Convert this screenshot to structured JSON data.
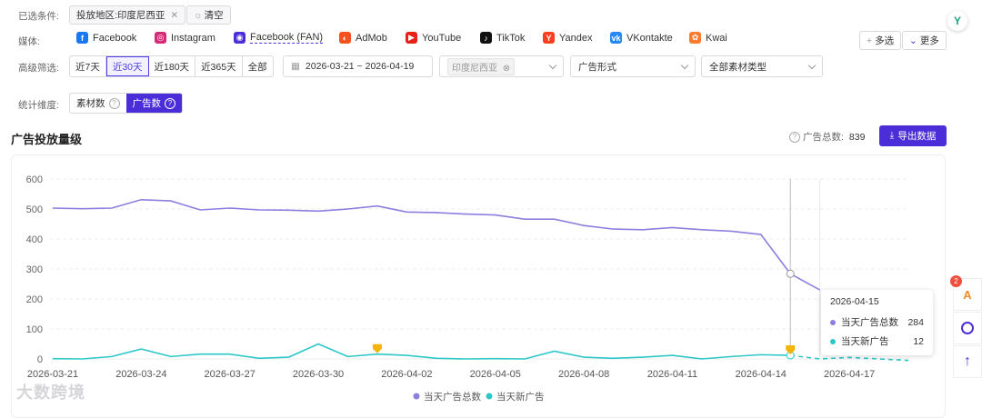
{
  "filters": {
    "label": "已选条件:",
    "region_tag": "投放地区:印度尼西亚",
    "clear_label": "清空"
  },
  "media": {
    "label": "媒体:",
    "items": [
      {
        "name": "Facebook",
        "color": "#1877f2"
      },
      {
        "name": "Instagram",
        "color": "#d62976"
      },
      {
        "name": "Facebook (FAN)",
        "color": "#4b2ed8"
      },
      {
        "name": "AdMob",
        "color": "#f4511e"
      },
      {
        "name": "YouTube",
        "color": "#e62117"
      },
      {
        "name": "TikTok",
        "color": "#111111"
      },
      {
        "name": "Yandex",
        "color": "#fc3f1d"
      },
      {
        "name": "VKontakte",
        "color": "#2787f5"
      },
      {
        "name": "Kwai",
        "color": "#ff7a2f"
      }
    ],
    "multi_label": "多选",
    "more_label": "更多"
  },
  "advanced": {
    "label": "高级筛选:",
    "ranges": [
      "近7天",
      "近30天",
      "近180天",
      "近365天",
      "全部"
    ],
    "active_range": "近30天",
    "date_range": "2026-03-21 ~ 2026-04-19",
    "region_select": "印度尼西亚",
    "ad_format_placeholder": "广告形式",
    "material_type": "全部素材类型"
  },
  "dimension": {
    "label": "统计维度:",
    "options": [
      "素材数",
      "广告数"
    ],
    "active": "广告数"
  },
  "section": {
    "title": "广告投放量级",
    "total_label": "广告总数:",
    "total_value": "839",
    "export_label": "导出数据"
  },
  "tooltip": {
    "date": "2026-04-15",
    "rows": [
      {
        "name": "当天广告总数",
        "value": "284"
      },
      {
        "name": "当天新广告",
        "value": "12"
      }
    ]
  },
  "side": {
    "badge": "2"
  },
  "watermark": "大数跨境",
  "chart_data": {
    "type": "line",
    "x": [
      "2026-03-21",
      "2026-03-22",
      "2026-03-23",
      "2026-03-24",
      "2026-03-25",
      "2026-03-26",
      "2026-03-27",
      "2026-03-28",
      "2026-03-29",
      "2026-03-30",
      "2026-03-31",
      "2026-04-01",
      "2026-04-02",
      "2026-04-03",
      "2026-04-04",
      "2026-04-05",
      "2026-04-06",
      "2026-04-07",
      "2026-04-08",
      "2026-04-09",
      "2026-04-10",
      "2026-04-11",
      "2026-04-12",
      "2026-04-13",
      "2026-04-14",
      "2026-04-15",
      "2026-04-16",
      "2026-04-17",
      "2026-04-18",
      "2026-04-19"
    ],
    "x_ticks": [
      "2026-03-21",
      "2026-03-24",
      "2026-03-27",
      "2026-03-30",
      "2026-04-02",
      "2026-04-05",
      "2026-04-08",
      "2026-04-11",
      "2026-04-14",
      "2026-04-17"
    ],
    "series": [
      {
        "name": "当天广告总数",
        "color": "#8b7fe0",
        "values": [
          503,
          501,
          503,
          531,
          527,
          497,
          503,
          497,
          496,
          493,
          500,
          510,
          490,
          488,
          483,
          480,
          466,
          466,
          445,
          433,
          431,
          438,
          431,
          426,
          415,
          284,
          230,
          null,
          null,
          null
        ]
      },
      {
        "name": "当天新广告",
        "color": "#2ec7c9",
        "values": [
          1,
          0,
          8,
          33,
          8,
          16,
          16,
          2,
          6,
          50,
          8,
          16,
          12,
          2,
          0,
          1,
          0,
          26,
          6,
          2,
          6,
          12,
          0,
          8,
          14,
          12,
          0,
          5,
          0,
          -5
        ],
        "dashed_from": 26
      }
    ],
    "ylim": [
      0,
      600
    ],
    "y_ticks": [
      0,
      100,
      200,
      300,
      400,
      500,
      600
    ],
    "grid": true,
    "legend": "bottom",
    "markers": [
      {
        "date": "2026-04-01",
        "series": 1
      },
      {
        "date": "2026-04-15",
        "series": 1
      }
    ],
    "highlight": "2026-04-15"
  }
}
